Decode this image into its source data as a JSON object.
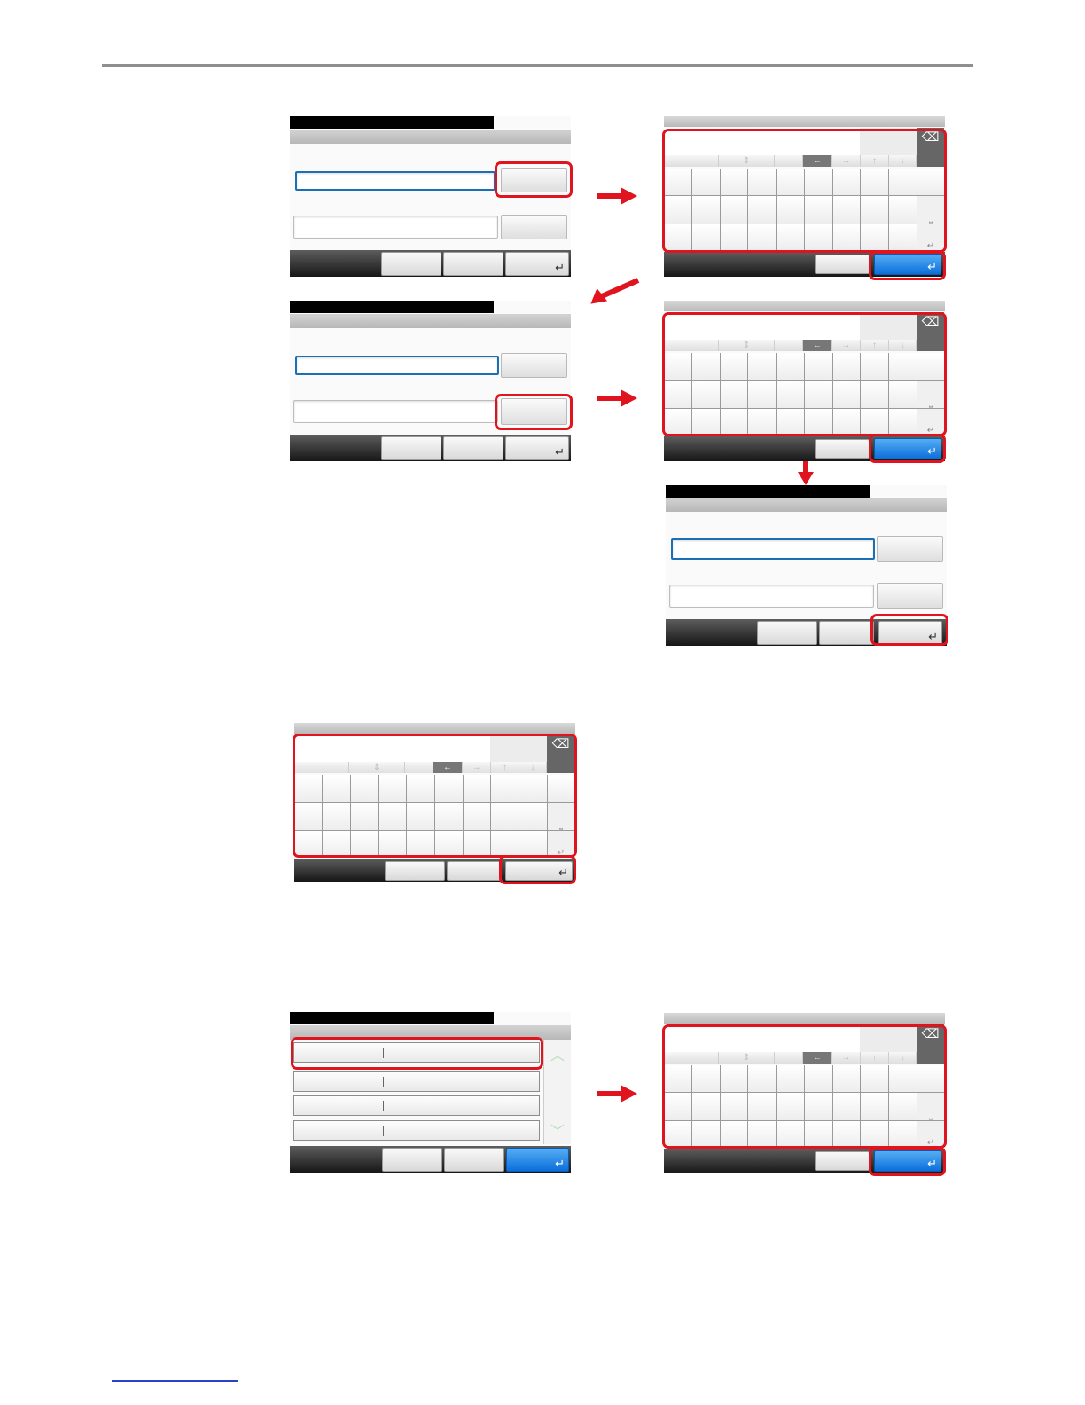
{
  "page": {
    "rule_color": "#8f8f8f",
    "accent_red": "#e0141e",
    "accent_blue": "#0b6fdc",
    "footer_link_color": "#2b3fc7"
  },
  "icons": {
    "backspace": "⌫",
    "left": "←",
    "right": "→",
    "up": "↑",
    "down": "↓",
    "space": "⎵",
    "enter": "↵",
    "scroll_up": "︿",
    "scroll_down": "﹀",
    "flow_arrow": "red-arrow-icon"
  },
  "figures": [
    {
      "id": "step1-form",
      "type": "form",
      "selected_field": 1,
      "highlight": "field1-button"
    },
    {
      "id": "step1-keyboard",
      "type": "keyboard",
      "highlight": [
        "keyboard",
        "ok-button"
      ]
    },
    {
      "id": "step2-form",
      "type": "form",
      "selected_field": 1,
      "highlight": "field2-button"
    },
    {
      "id": "step2-keyboard",
      "type": "keyboard",
      "highlight": [
        "keyboard",
        "ok-button"
      ]
    },
    {
      "id": "step3-form",
      "type": "form",
      "selected_field": 1,
      "highlight": "confirm-button"
    },
    {
      "id": "keyboard-only",
      "type": "keyboard",
      "highlight": [
        "keyboard",
        "ok-button"
      ]
    },
    {
      "id": "list-screen",
      "type": "list",
      "rows": 4,
      "highlight": "first-row"
    },
    {
      "id": "list-keyboard",
      "type": "keyboard",
      "highlight": [
        "keyboard",
        "ok-button"
      ]
    }
  ]
}
